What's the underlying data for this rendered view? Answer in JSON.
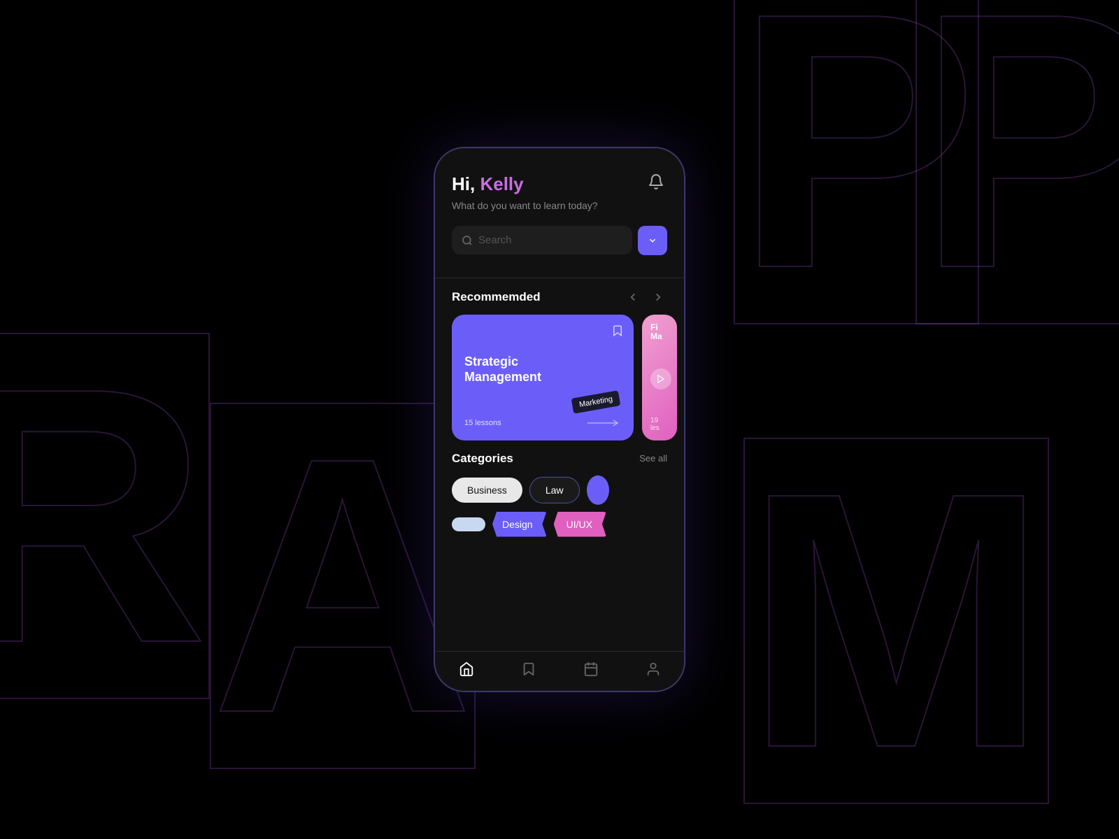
{
  "background": {
    "letters": [
      "P",
      "P",
      "R",
      "A",
      "M"
    ]
  },
  "phone": {
    "header": {
      "greeting_prefix": "Hi, ",
      "greeting_name": "Kelly",
      "subtitle": "What do you want to learn today?"
    },
    "search": {
      "placeholder": "Search",
      "dropdown_label": "dropdown"
    },
    "recommended": {
      "title": "Recommemded",
      "prev_label": "‹",
      "next_label": "›",
      "cards": [
        {
          "title": "Strategic Management",
          "tag": "Marketing",
          "lessons": "15 lessons",
          "color": "#6b5ef8"
        },
        {
          "title": "Fi... Ma...",
          "lessons": "19 les",
          "color": "#e060c0"
        }
      ]
    },
    "categories": {
      "title": "Categories",
      "see_all": "See all",
      "chips_row1": [
        "Business",
        "Law"
      ],
      "chips_row2": [
        "",
        "Design",
        "UI/UX"
      ]
    },
    "bottom_nav": {
      "items": [
        {
          "name": "home",
          "active": true
        },
        {
          "name": "bookmark",
          "active": false
        },
        {
          "name": "calendar",
          "active": false
        },
        {
          "name": "profile",
          "active": false
        }
      ]
    }
  }
}
